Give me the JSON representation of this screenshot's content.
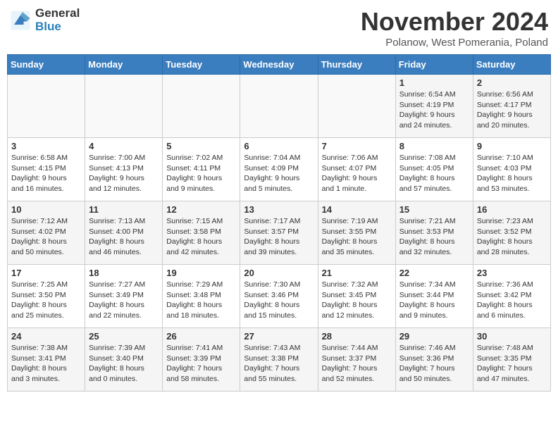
{
  "logo": {
    "general": "General",
    "blue": "Blue"
  },
  "title": "November 2024",
  "subtitle": "Polanow, West Pomerania, Poland",
  "weekdays": [
    "Sunday",
    "Monday",
    "Tuesday",
    "Wednesday",
    "Thursday",
    "Friday",
    "Saturday"
  ],
  "weeks": [
    [
      {
        "day": "",
        "info": ""
      },
      {
        "day": "",
        "info": ""
      },
      {
        "day": "",
        "info": ""
      },
      {
        "day": "",
        "info": ""
      },
      {
        "day": "",
        "info": ""
      },
      {
        "day": "1",
        "info": "Sunrise: 6:54 AM\nSunset: 4:19 PM\nDaylight: 9 hours\nand 24 minutes."
      },
      {
        "day": "2",
        "info": "Sunrise: 6:56 AM\nSunset: 4:17 PM\nDaylight: 9 hours\nand 20 minutes."
      }
    ],
    [
      {
        "day": "3",
        "info": "Sunrise: 6:58 AM\nSunset: 4:15 PM\nDaylight: 9 hours\nand 16 minutes."
      },
      {
        "day": "4",
        "info": "Sunrise: 7:00 AM\nSunset: 4:13 PM\nDaylight: 9 hours\nand 12 minutes."
      },
      {
        "day": "5",
        "info": "Sunrise: 7:02 AM\nSunset: 4:11 PM\nDaylight: 9 hours\nand 9 minutes."
      },
      {
        "day": "6",
        "info": "Sunrise: 7:04 AM\nSunset: 4:09 PM\nDaylight: 9 hours\nand 5 minutes."
      },
      {
        "day": "7",
        "info": "Sunrise: 7:06 AM\nSunset: 4:07 PM\nDaylight: 9 hours\nand 1 minute."
      },
      {
        "day": "8",
        "info": "Sunrise: 7:08 AM\nSunset: 4:05 PM\nDaylight: 8 hours\nand 57 minutes."
      },
      {
        "day": "9",
        "info": "Sunrise: 7:10 AM\nSunset: 4:03 PM\nDaylight: 8 hours\nand 53 minutes."
      }
    ],
    [
      {
        "day": "10",
        "info": "Sunrise: 7:12 AM\nSunset: 4:02 PM\nDaylight: 8 hours\nand 50 minutes."
      },
      {
        "day": "11",
        "info": "Sunrise: 7:13 AM\nSunset: 4:00 PM\nDaylight: 8 hours\nand 46 minutes."
      },
      {
        "day": "12",
        "info": "Sunrise: 7:15 AM\nSunset: 3:58 PM\nDaylight: 8 hours\nand 42 minutes."
      },
      {
        "day": "13",
        "info": "Sunrise: 7:17 AM\nSunset: 3:57 PM\nDaylight: 8 hours\nand 39 minutes."
      },
      {
        "day": "14",
        "info": "Sunrise: 7:19 AM\nSunset: 3:55 PM\nDaylight: 8 hours\nand 35 minutes."
      },
      {
        "day": "15",
        "info": "Sunrise: 7:21 AM\nSunset: 3:53 PM\nDaylight: 8 hours\nand 32 minutes."
      },
      {
        "day": "16",
        "info": "Sunrise: 7:23 AM\nSunset: 3:52 PM\nDaylight: 8 hours\nand 28 minutes."
      }
    ],
    [
      {
        "day": "17",
        "info": "Sunrise: 7:25 AM\nSunset: 3:50 PM\nDaylight: 8 hours\nand 25 minutes."
      },
      {
        "day": "18",
        "info": "Sunrise: 7:27 AM\nSunset: 3:49 PM\nDaylight: 8 hours\nand 22 minutes."
      },
      {
        "day": "19",
        "info": "Sunrise: 7:29 AM\nSunset: 3:48 PM\nDaylight: 8 hours\nand 18 minutes."
      },
      {
        "day": "20",
        "info": "Sunrise: 7:30 AM\nSunset: 3:46 PM\nDaylight: 8 hours\nand 15 minutes."
      },
      {
        "day": "21",
        "info": "Sunrise: 7:32 AM\nSunset: 3:45 PM\nDaylight: 8 hours\nand 12 minutes."
      },
      {
        "day": "22",
        "info": "Sunrise: 7:34 AM\nSunset: 3:44 PM\nDaylight: 8 hours\nand 9 minutes."
      },
      {
        "day": "23",
        "info": "Sunrise: 7:36 AM\nSunset: 3:42 PM\nDaylight: 8 hours\nand 6 minutes."
      }
    ],
    [
      {
        "day": "24",
        "info": "Sunrise: 7:38 AM\nSunset: 3:41 PM\nDaylight: 8 hours\nand 3 minutes."
      },
      {
        "day": "25",
        "info": "Sunrise: 7:39 AM\nSunset: 3:40 PM\nDaylight: 8 hours\nand 0 minutes."
      },
      {
        "day": "26",
        "info": "Sunrise: 7:41 AM\nSunset: 3:39 PM\nDaylight: 7 hours\nand 58 minutes."
      },
      {
        "day": "27",
        "info": "Sunrise: 7:43 AM\nSunset: 3:38 PM\nDaylight: 7 hours\nand 55 minutes."
      },
      {
        "day": "28",
        "info": "Sunrise: 7:44 AM\nSunset: 3:37 PM\nDaylight: 7 hours\nand 52 minutes."
      },
      {
        "day": "29",
        "info": "Sunrise: 7:46 AM\nSunset: 3:36 PM\nDaylight: 7 hours\nand 50 minutes."
      },
      {
        "day": "30",
        "info": "Sunrise: 7:48 AM\nSunset: 3:35 PM\nDaylight: 7 hours\nand 47 minutes."
      }
    ]
  ]
}
